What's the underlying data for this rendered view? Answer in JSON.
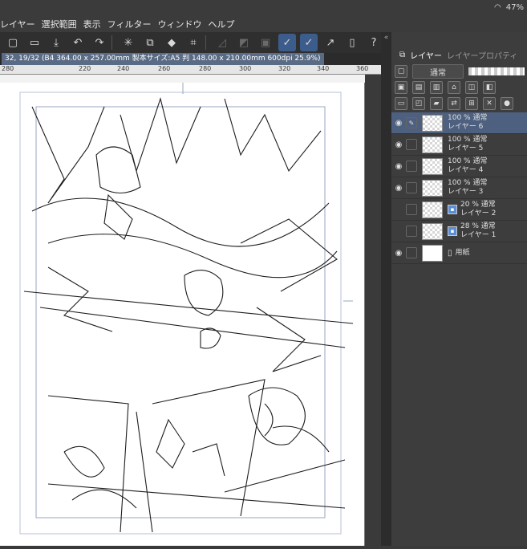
{
  "status": {
    "battery": "47%"
  },
  "menu": {
    "items": [
      "レイヤー",
      "選択範囲",
      "表示",
      "フィルター",
      "ウィンドウ",
      "ヘルプ"
    ]
  },
  "document": {
    "info": "32, 19/32 (B4 364.00 x 257.00mm 製本サイズ:A5 判 148.00 x 210.00mm 600dpi 25.9%)"
  },
  "ruler": {
    "ticks": [
      "280",
      "220",
      "240",
      "260",
      "280",
      "300",
      "320",
      "340",
      "360"
    ]
  },
  "panel": {
    "tab_layer": "レイヤー",
    "tab_property": "レイヤープロパティ",
    "blend_mode": "通常"
  },
  "layers": [
    {
      "opacity": "100 %",
      "mode": "通常",
      "name": "レイヤー 6",
      "selected": true
    },
    {
      "opacity": "100 %",
      "mode": "通常",
      "name": "レイヤー 5"
    },
    {
      "opacity": "100 %",
      "mode": "通常",
      "name": "レイヤー 4"
    },
    {
      "opacity": "100 %",
      "mode": "通常",
      "name": "レイヤー 3"
    },
    {
      "opacity": "20 %",
      "mode": "通常",
      "name": "レイヤー 2"
    },
    {
      "opacity": "28 %",
      "mode": "通常",
      "name": "レイヤー 1"
    },
    {
      "opacity": "",
      "mode": "",
      "name": "用紙"
    }
  ],
  "colors": {
    "accent": "#4e607f",
    "toolbar_active": "#3c5d8c"
  }
}
